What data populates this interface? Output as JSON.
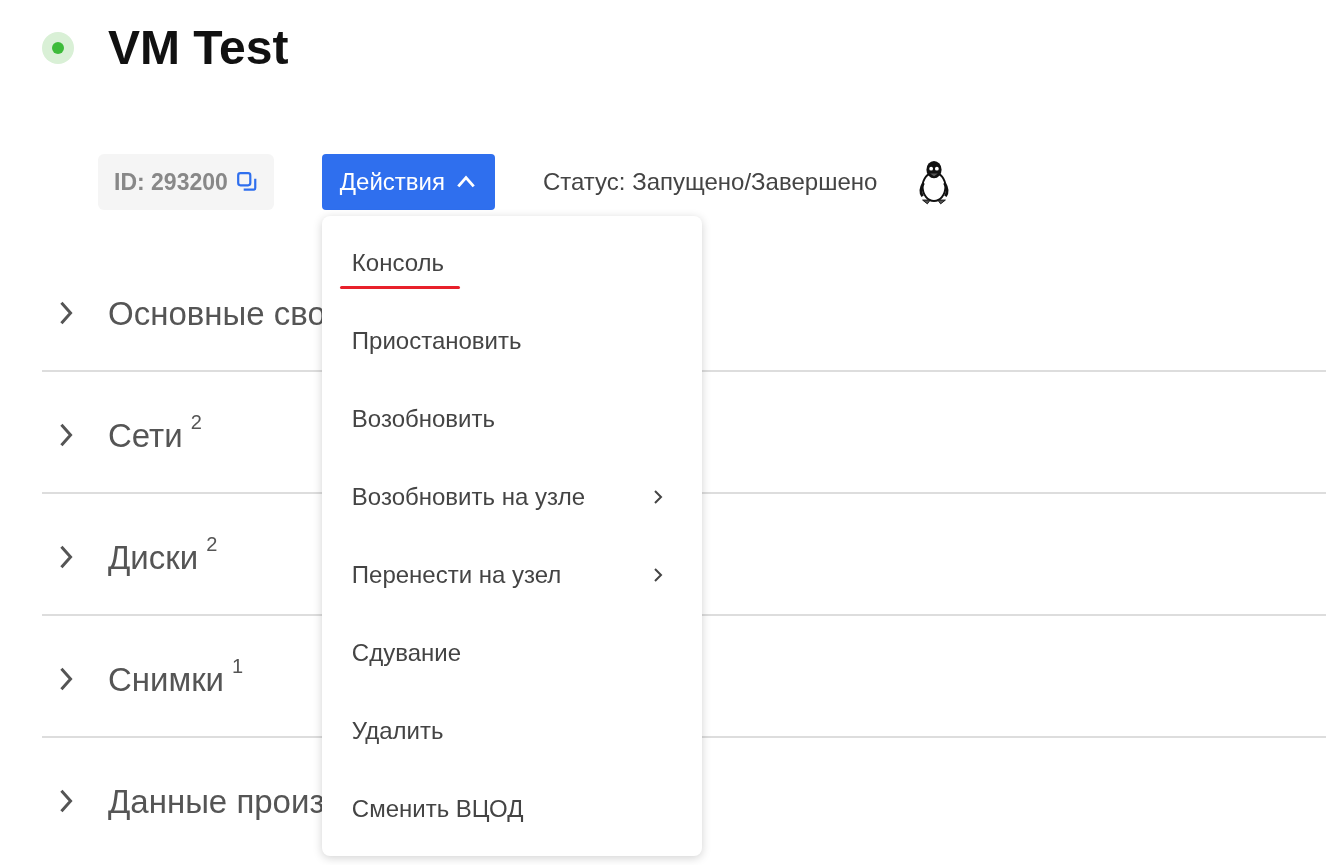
{
  "vm": {
    "title": "VM Test",
    "running": true
  },
  "toolbar": {
    "id_label": "ID: 293200",
    "actions_button": {
      "label": "Действия",
      "expanded": true
    },
    "status": "Статус: Запущено/Завершено"
  },
  "sections": [
    {
      "title": "Основные сво",
      "expanded": false
    },
    {
      "title": "Сети",
      "count": "2",
      "expanded": false
    },
    {
      "title": "Диски",
      "count": "2",
      "expanded": false
    },
    {
      "title": "Снимки",
      "count": "1",
      "expanded": false
    },
    {
      "title": "Данные произ",
      "expanded": false
    }
  ],
  "actions_menu": [
    {
      "label": "Консоль",
      "kind": "action",
      "selected": true
    },
    {
      "label": "Приостановить",
      "kind": "action",
      "selected": false
    },
    {
      "label": "Возобновить",
      "kind": "action",
      "selected": false
    },
    {
      "label": "Возобновить на узле",
      "kind": "submenu",
      "selected": false
    },
    {
      "label": "Перенести на узел",
      "kind": "submenu",
      "selected": false
    },
    {
      "label": "Сдувание",
      "kind": "action",
      "selected": false
    },
    {
      "label": "Удалить",
      "kind": "action",
      "selected": false
    },
    {
      "label": "Сменить ВЦОД",
      "kind": "action",
      "selected": false
    }
  ]
}
